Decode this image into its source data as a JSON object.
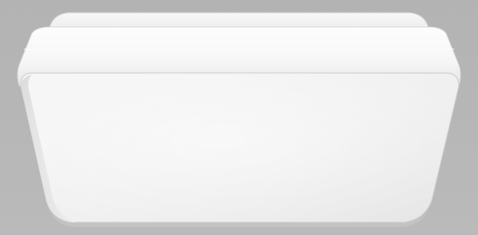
{
  "image": {
    "subject": "square-ceiling-light-fixture",
    "colors": {
      "background": "#b6b6b6",
      "housing": "#f2f2f2",
      "trim_band": "#fafafa",
      "diffuser": "#efefef",
      "edge_shadow": "#c9c9c9"
    }
  }
}
